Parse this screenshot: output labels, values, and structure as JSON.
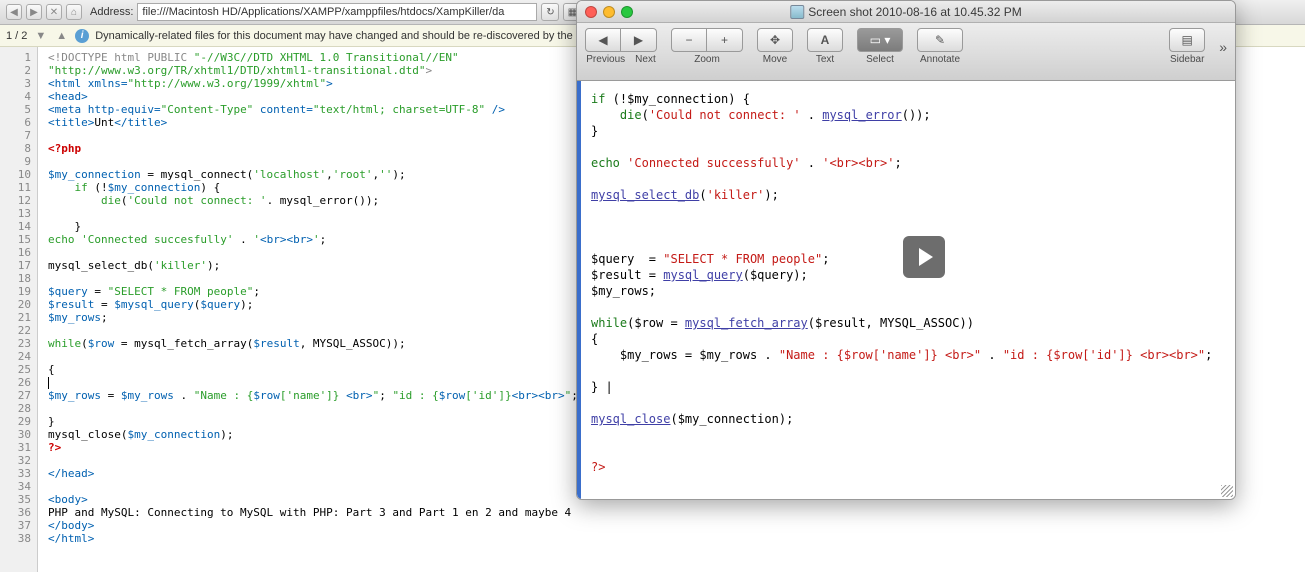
{
  "browser": {
    "address_label": "Address:",
    "address_value": "file:///Macintosh HD/Applications/XAMPP/xamppfiles/htdocs/XampKiller/da"
  },
  "pager": {
    "text": "1 / 2"
  },
  "info_message": "Dynamically-related files for this document may have changed and should be re-discovered by the serv",
  "code_lines": [
    "<!DOCTYPE html PUBLIC \"-//W3C//DTD XHTML 1.0 Transitional//EN\"",
    "\"http://www.w3.org/TR/xhtml1/DTD/xhtml1-transitional.dtd\">",
    "<html xmlns=\"http://www.w3.org/1999/xhtml\">",
    "<head>",
    "<meta http-equiv=\"Content-Type\" content=\"text/html; charset=UTF-8\" />",
    "<title>Unt</title>",
    "",
    "<?php",
    "",
    "$my_connection = mysql_connect('localhost','root','');",
    "    if (!$my_connection) {",
    "        die('Could not connect: '. mysql_error());",
    "",
    "    }",
    "echo 'Connected succesfully' . '<br><br>';",
    "",
    "mysql_select_db('killer');",
    "",
    "$query = \"SELECT * FROM people\";",
    "$result = $mysql_query($query);",
    "$my_rows;",
    "",
    "while($row = mysql_fetch_array($result, MYSQL_ASSOC));",
    "",
    "{",
    "|",
    "$my_rows = $my_rows . \"Name : {$row['name']} <br>\"; \"id : {$row['id']}<br><br>\";",
    "",
    "}",
    "mysql_close($my_connection);",
    "?>",
    "",
    "</head>",
    "",
    "<body>",
    "PHP and MySQL: Connecting to MySQL with PHP: Part 3 and Part 1 en 2 and maybe 4",
    "</body>",
    "</html>"
  ],
  "preview": {
    "title": "Screen shot 2010-08-16 at 10.45.32 PM",
    "toolbar": {
      "previous": "Previous",
      "next": "Next",
      "zoom": "Zoom",
      "move": "Move",
      "text": "Text",
      "select": "Select",
      "annotate": "Annotate",
      "sidebar": "Sidebar"
    },
    "body": [
      "if (!$my_connection) {",
      "    die('Could not connect: ' . mysql_error());",
      "}",
      "",
      "echo 'Connected successfully' . '<br><br>';",
      "",
      "mysql_select_db('killer');",
      "",
      "",
      "",
      "$query  = \"SELECT * FROM people\";",
      "$result = mysql_query($query);",
      "$my_rows;",
      "",
      "while($row = mysql_fetch_array($result, MYSQL_ASSOC))",
      "{",
      "    $my_rows = $my_rows . \"Name : {$row['name']} <br>\" . \"id : {$row['id']} <br><br>\";",
      "",
      "} |",
      "",
      "mysql_close($my_connection);",
      "",
      "",
      "?>"
    ]
  }
}
